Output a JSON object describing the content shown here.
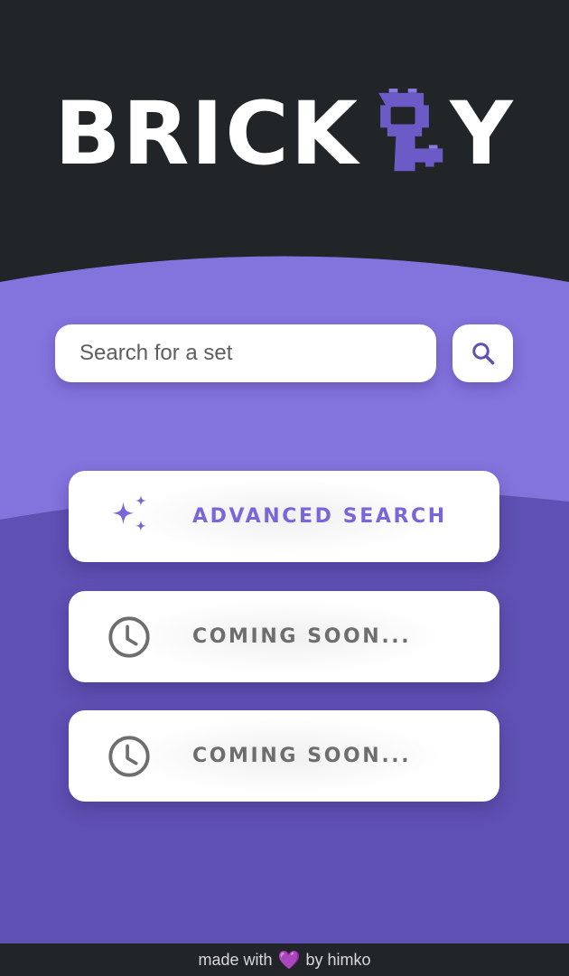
{
  "app": {
    "logo_prefix": "BRICK",
    "logo_suffix": "Y",
    "logo_icon": "brick-key-icon"
  },
  "colors": {
    "header_bg": "#222528",
    "accent_light": "#8373dd",
    "accent_dark": "#5f50b3",
    "accent_text": "#7a66d8",
    "muted_text": "#6e6e6e"
  },
  "search": {
    "placeholder": "Search for a set",
    "value": "",
    "button_icon": "search-icon"
  },
  "menu": {
    "advanced_search": {
      "label": "ADVANCED SEARCH",
      "icon": "sparkle-icon"
    },
    "coming_soon_1": {
      "label": "COMING SOON...",
      "icon": "clock-icon"
    },
    "coming_soon_2": {
      "label": "COMING SOON...",
      "icon": "clock-icon"
    }
  },
  "footer": {
    "prefix": "made with",
    "heart": "💜",
    "suffix": "by himko"
  }
}
